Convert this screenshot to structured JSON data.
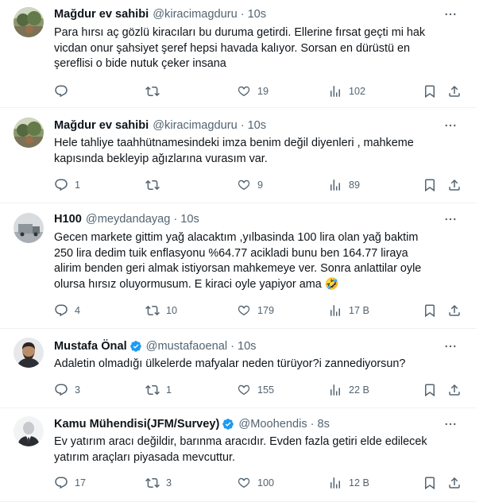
{
  "tweets": [
    {
      "name": "Mağdur ev sahibi",
      "handle": "@kiracimagduru",
      "time": "10s",
      "verified": false,
      "avatar": "landscape-avatar",
      "text": "Para hırsı aç gözlü kiracıları bu duruma getirdi. Ellerine fırsat geçti mi hak\nvicdan onur şahsiyet şeref hepsi havada kalıyor. Sorsan en dürüstü en\nşereflisi o bide nutuk çeker insana",
      "replies": "",
      "retweets": "",
      "likes": "19",
      "views": "102"
    },
    {
      "name": "Mağdur ev sahibi",
      "handle": "@kiracimagduru",
      "time": "10s",
      "verified": false,
      "avatar": "landscape-avatar",
      "text": "Hele tahliye taahhütnamesindeki imza  benim değil diyenleri , mahkeme\nkapısında bekleyip ağızlarına vurasım var.",
      "replies": "1",
      "retweets": "",
      "likes": "9",
      "views": "89"
    },
    {
      "name": "H100",
      "handle": "@meydandayag",
      "time": "10s",
      "verified": false,
      "avatar": "truck-avatar",
      "text": "Gecen markete gittim yağ alacaktım ,yılbasinda 100 lira olan yağ baktim\n250 lira dedim tuik enflasyonu %64.77 acikladi bunu ben 164.77 liraya\nalirim benden geri almak istiyorsan mahkemeye ver. Sonra anlattilar oyle\nolursa hırsız oluyormusum. E kiraci oyle yapiyor ama 🤣",
      "replies": "4",
      "retweets": "10",
      "likes": "179",
      "views": "17 B"
    },
    {
      "name": "Mustafa Önal",
      "handle": "@mustafaoenal",
      "time": "10s",
      "verified": true,
      "avatar": "man-avatar",
      "text": "Adaletin olmadığı ülkelerde mafyalar neden türüyor?i zannediyorsun?",
      "replies": "3",
      "retweets": "1",
      "likes": "155",
      "views": "22 B"
    },
    {
      "name": "Kamu Mühendisi(JFM/Survey)",
      "handle": "@Moohendis",
      "time": "8s",
      "verified": true,
      "avatar": "suit-avatar",
      "text": "Ev yatırım aracı değildir, barınma aracıdır. Evden fazla getiri elde edilecek\nyatırım araçları piyasada mevcuttur.",
      "replies": "17",
      "retweets": "3",
      "likes": "100",
      "views": "12 B"
    }
  ],
  "colors": {
    "text": "#0f1419",
    "secondary": "#536471",
    "verified": "#1d9bf0",
    "divider": "#eff3f4"
  }
}
